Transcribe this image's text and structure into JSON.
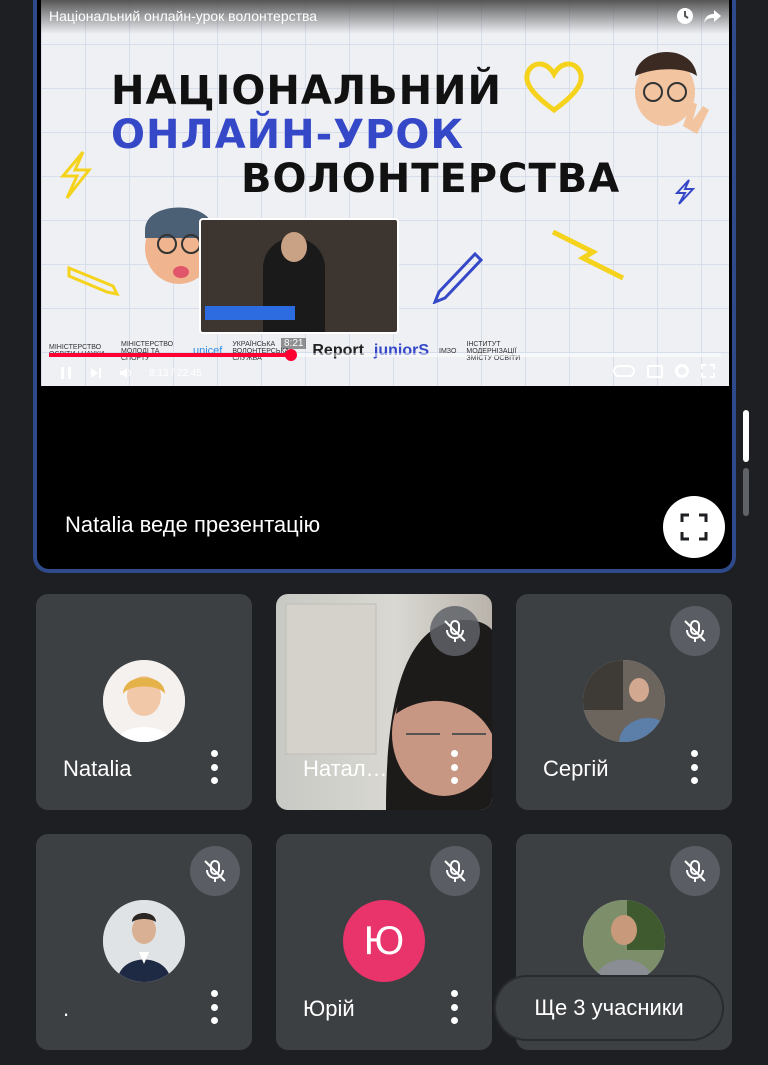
{
  "video": {
    "title": "Національний онлайн-урок волонтерства",
    "headline_line1": "НАЦІОНАЛЬНИЙ",
    "headline_line2": "ОНЛАЙН-УРОК",
    "headline_line3": "ВОЛОНТЕРСТВА",
    "time": "8:13 / 22:45",
    "hover_time": "8:21",
    "progress": 0.36,
    "logos": [
      "МІНІСТЕРСТВО ОСВІТИ І НАУКИ",
      "МІНІСТЕРСТВО МОЛОДІ ТА СПОРТУ",
      "unicef",
      "УКРАЇНСЬКА ВОЛОНТЕРСЬКА СЛУЖБА",
      "Report",
      "juniorS",
      "ІМЗО",
      "ІНСТИТУТ МОДЕРНІЗАЦІЇ ЗМІСТУ ОСВІТИ"
    ]
  },
  "presentation": {
    "presenter_label": "Natalia веде презентацію"
  },
  "participants": [
    {
      "name": "Natalia",
      "muted": false,
      "type": "avatar"
    },
    {
      "name": "Натал…",
      "muted": true,
      "type": "camera"
    },
    {
      "name": "Сергій",
      "muted": true,
      "type": "avatar"
    },
    {
      "name": ".",
      "muted": true,
      "type": "avatar"
    },
    {
      "name": "Юрій",
      "muted": true,
      "type": "initial",
      "initial": "Ю"
    },
    {
      "name": "",
      "muted": true,
      "type": "avatar"
    }
  ],
  "more_participants": "Ще 3 учасники",
  "colors": {
    "background": "#1e1f22",
    "tile": "#3c4043",
    "accent_border": "#2f4a8a",
    "initial_avatar": "#e8336b",
    "progress": "#ff0033"
  }
}
